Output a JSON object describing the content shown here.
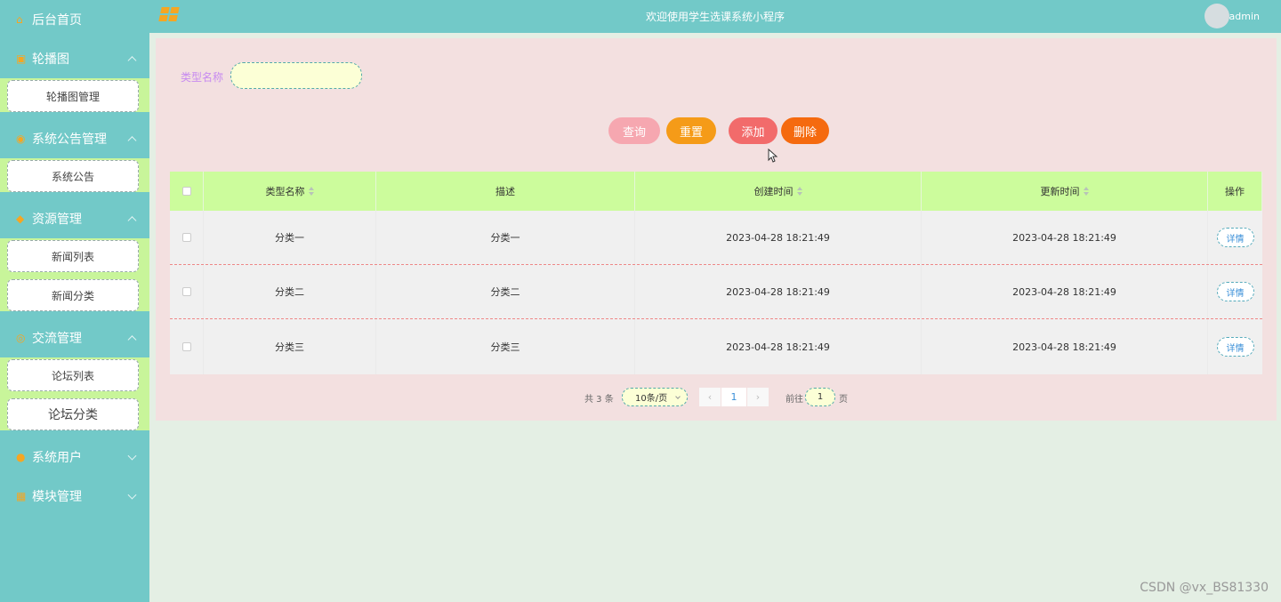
{
  "sidebar": {
    "home": "后台首页",
    "carousel": {
      "label": "轮播图",
      "items": [
        "轮播图管理"
      ]
    },
    "notice": {
      "label": "系统公告管理",
      "items": [
        "系统公告"
      ]
    },
    "resource": {
      "label": "资源管理",
      "items": [
        "新闻列表",
        "新闻分类"
      ]
    },
    "community": {
      "label": "交流管理",
      "items": [
        "论坛列表",
        "论坛分类"
      ]
    },
    "users": {
      "label": "系统用户"
    },
    "modules": {
      "label": "模块管理"
    }
  },
  "header": {
    "title": "欢迎使用学生选课系统小程序",
    "user": "admin"
  },
  "search": {
    "label": "类型名称",
    "value": ""
  },
  "actions": {
    "query": "查询",
    "reset": "重置",
    "add": "添加",
    "delete": "删除"
  },
  "table": {
    "headers": [
      "类型名称",
      "描述",
      "创建时间",
      "更新时间",
      "操作"
    ],
    "rows": [
      {
        "name": "分类一",
        "desc": "分类一",
        "created": "2023-04-28 18:21:49",
        "updated": "2023-04-28 18:21:49",
        "action": "详情"
      },
      {
        "name": "分类二",
        "desc": "分类二",
        "created": "2023-04-28 18:21:49",
        "updated": "2023-04-28 18:21:49",
        "action": "详情"
      },
      {
        "name": "分类三",
        "desc": "分类三",
        "created": "2023-04-28 18:21:49",
        "updated": "2023-04-28 18:21:49",
        "action": "详情"
      }
    ]
  },
  "pagination": {
    "total": "共 3 条",
    "page_size": "10条/页",
    "current_page": "1",
    "goto_label": "前往",
    "goto_value": "1",
    "unit": "页"
  },
  "watermark": "CSDN @vx_BS81330",
  "colors": {
    "sidebar": "#72c9c8",
    "submenu": "#c8f59a",
    "panel": "#f3e0e0",
    "table_header": "#ccfc9c"
  }
}
